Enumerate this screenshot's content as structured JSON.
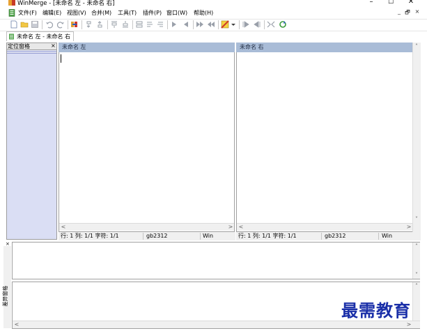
{
  "window": {
    "title": "WinMerge - [未命名 左 - 未命名 右]",
    "minimize": "–",
    "maximize": "☐",
    "close": "✕"
  },
  "menu": {
    "items": [
      "文件(F)",
      "编辑(E)",
      "视图(V)",
      "合并(M)",
      "工具(T)",
      "插件(P)",
      "窗口(W)",
      "帮助(H)"
    ],
    "mdi_minimize": "_",
    "mdi_restore": "🗗",
    "mdi_close": "×"
  },
  "tab": {
    "label": "未命名 左 - 未命名 右"
  },
  "location_pane": {
    "title": "定位窗格",
    "close": "×"
  },
  "left_pane": {
    "header": "未命名 左",
    "status": {
      "position": "行: 1  列: 1/1  字符: 1/1",
      "encoding": "gb2312",
      "eol": "Win"
    }
  },
  "right_pane": {
    "header": "未命名 右",
    "status": {
      "position": "行: 1  列: 1/1  字符: 1/1",
      "encoding": "gb2312",
      "eol": "Win"
    }
  },
  "diff_pane": {
    "title": "差异窗格",
    "close": "×"
  },
  "watermark": "最需教育",
  "colors": {
    "pane_header_bg": "#a9bcd7",
    "location_pane_bg": "#dadef4",
    "watermark": "#1a2fa8"
  }
}
